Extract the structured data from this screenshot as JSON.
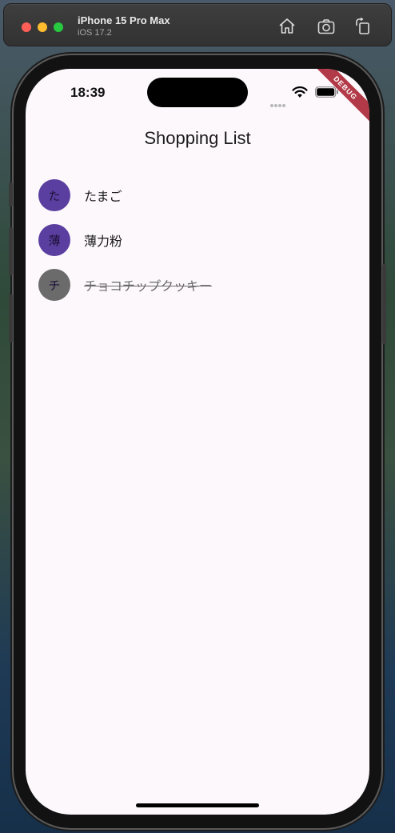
{
  "simulator": {
    "device_name": "iPhone 15 Pro Max",
    "os_version": "iOS 17.2",
    "icons": [
      "home-icon",
      "screenshot-icon",
      "rotate-icon"
    ]
  },
  "status_bar": {
    "time": "18:39",
    "icons": [
      "signal-dots-icon",
      "wifi-icon",
      "battery-icon"
    ]
  },
  "debug_banner": "DEBUG",
  "app": {
    "title": "Shopping List",
    "items": [
      {
        "initial": "た",
        "name": "たまご",
        "purchased": false,
        "avatar_color": "#5b3fa0"
      },
      {
        "initial": "薄",
        "name": "薄力粉",
        "purchased": false,
        "avatar_color": "#5b3fa0"
      },
      {
        "initial": "チ",
        "name": "チョコチップクッキー",
        "purchased": true,
        "avatar_color": "#6b6b6b"
      }
    ]
  },
  "colors": {
    "accent": "#5b3fa0",
    "inactive": "#6b6b6b",
    "background": "#fdf8fc",
    "ribbon": "#b23a48"
  }
}
